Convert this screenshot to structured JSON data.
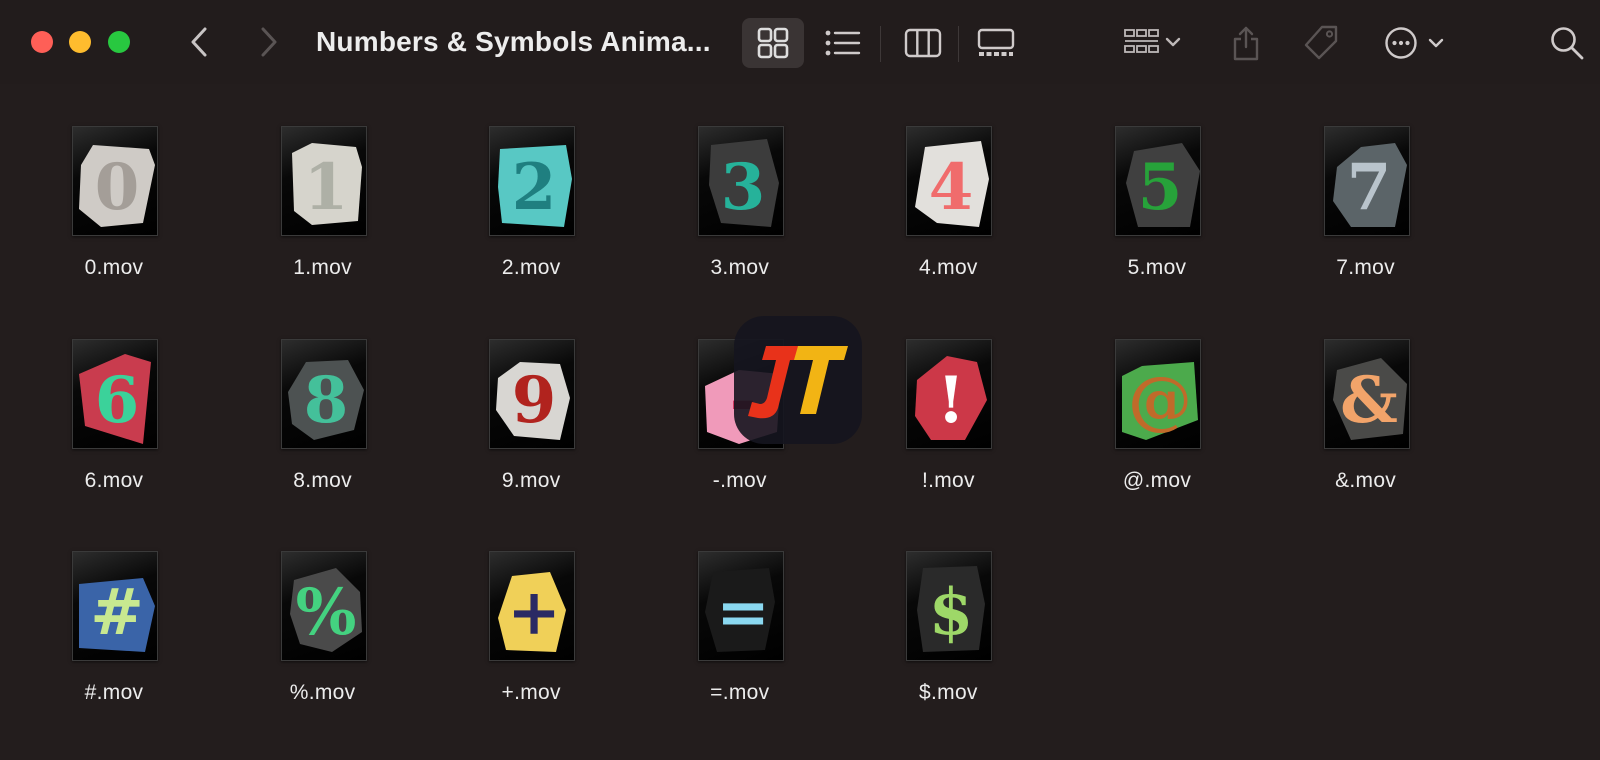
{
  "window": {
    "title": "Numbers & Symbols Anima..."
  },
  "toolbar": {
    "back_icon": "chevron-left-icon",
    "forward_icon": "chevron-right-icon",
    "view_modes": [
      "icon-view",
      "list-view",
      "column-view",
      "gallery-view"
    ],
    "selected_view": "icon-view",
    "group_icon": "group-by-icon",
    "share_icon": "share-icon",
    "tag_icon": "tag-icon",
    "more_icon": "ellipsis-icon",
    "search_icon": "search-icon"
  },
  "files": [
    {
      "name": "0.mov",
      "glyph": "0",
      "paper": "#cfcbc6",
      "ink": "#a49e98"
    },
    {
      "name": "1.mov",
      "glyph": "1",
      "paper": "#d6d4cc",
      "ink": "#aeb0a6"
    },
    {
      "name": "2.mov",
      "glyph": "2",
      "paper": "#58c8c4",
      "ink": "#1f7f80"
    },
    {
      "name": "3.mov",
      "glyph": "3",
      "paper": "#3c3c3c",
      "ink": "#26b29a"
    },
    {
      "name": "4.mov",
      "glyph": "4",
      "paper": "#e2e0dc",
      "ink": "#f06c6c"
    },
    {
      "name": "5.mov",
      "glyph": "5",
      "paper": "#404040",
      "ink": "#27a23a"
    },
    {
      "name": "7.mov",
      "glyph": "7",
      "paper": "#5b6468",
      "ink": "#b9c4cc"
    },
    {
      "name": "6.mov",
      "glyph": "6",
      "paper": "#c93c4e",
      "ink": "#3bd29a"
    },
    {
      "name": "8.mov",
      "glyph": "8",
      "paper": "#4d5252",
      "ink": "#44c09a"
    },
    {
      "name": "9.mov",
      "glyph": "9",
      "paper": "#d8d6d2",
      "ink": "#b1231e"
    },
    {
      "name": "-.mov",
      "glyph": "-",
      "paper": "#f09aba",
      "ink": "#c8204a"
    },
    {
      "name": "!.mov",
      "glyph": "!",
      "paper": "#cc3848",
      "ink": "#ffffff"
    },
    {
      "name": "@.mov",
      "glyph": "@",
      "paper": "#4caa4c",
      "ink": "#c06a2a"
    },
    {
      "name": "&.mov",
      "glyph": "&",
      "paper": "#4a4a48",
      "ink": "#f2a46a"
    },
    {
      "name": "#.mov",
      "glyph": "#",
      "paper": "#3a64a8",
      "ink": "#c8e890"
    },
    {
      "name": "%.mov",
      "glyph": "%",
      "paper": "#4a4a4a",
      "ink": "#44d280"
    },
    {
      "name": "+.mov",
      "glyph": "+",
      "paper": "#f0d058",
      "ink": "#2a2a64"
    },
    {
      "name": "=.mov",
      "glyph": "=",
      "paper": "#1a1a1a",
      "ink": "#8ad8f0"
    },
    {
      "name": "$.mov",
      "glyph": "$",
      "paper": "#2a2a2a",
      "ink": "#9ed868"
    }
  ],
  "watermark": {
    "text": "JT",
    "colors": [
      "#e8321a",
      "#f2b414"
    ]
  }
}
